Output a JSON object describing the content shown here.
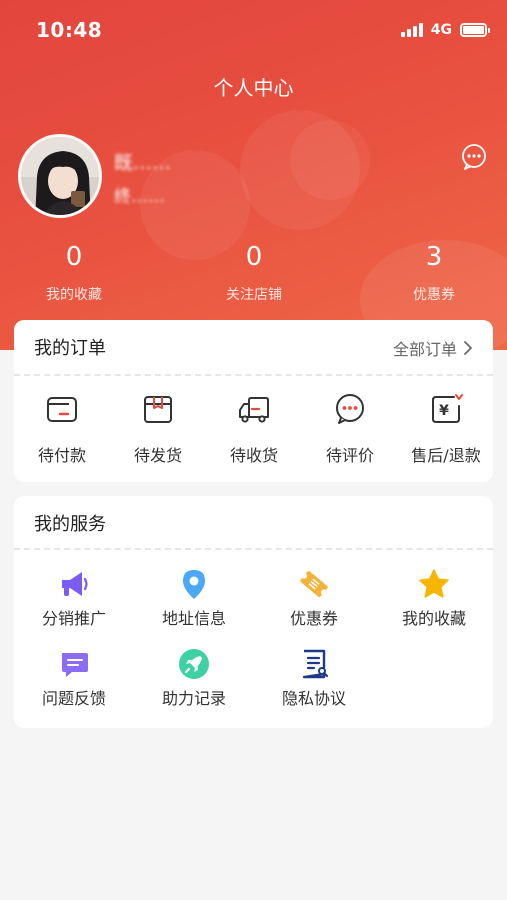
{
  "status_bar": {
    "time": "10:48",
    "network": "4G"
  },
  "header": {
    "title": "个人中心"
  },
  "profile": {
    "name": "既……",
    "subtitle": "终……"
  },
  "stats": [
    {
      "value": "0",
      "label": "我的收藏"
    },
    {
      "value": "0",
      "label": "关注店铺"
    },
    {
      "value": "3",
      "label": "优惠券"
    }
  ],
  "orders": {
    "title": "我的订单",
    "all_link": "全部订单",
    "items": [
      {
        "label": "待付款",
        "icon": "wallet-icon"
      },
      {
        "label": "待发货",
        "icon": "package-icon"
      },
      {
        "label": "待收货",
        "icon": "truck-icon"
      },
      {
        "label": "待评价",
        "icon": "comment-icon"
      },
      {
        "label": "售后/退款",
        "icon": "refund-icon"
      }
    ]
  },
  "services": {
    "title": "我的服务",
    "items": [
      {
        "label": "分销推广",
        "icon": "megaphone-icon"
      },
      {
        "label": "地址信息",
        "icon": "location-pin-icon"
      },
      {
        "label": "优惠券",
        "icon": "coupon-icon"
      },
      {
        "label": "我的收藏",
        "icon": "star-icon"
      },
      {
        "label": "问题反馈",
        "icon": "feedback-icon"
      },
      {
        "label": "助力记录",
        "icon": "rocket-icon"
      },
      {
        "label": "隐私协议",
        "icon": "document-icon"
      }
    ]
  },
  "colors": {
    "header_gradient_start": "#e2453d",
    "header_gradient_end": "#ef6848",
    "accent_red": "#e54b3c",
    "megaphone": "#7a5cf0",
    "location": "#4aa8f5",
    "coupon": "#f3b33a",
    "star": "#f7b500",
    "feedback": "#8b6cf2",
    "rocket": "#3fd0a4",
    "document": "#1e3a8a"
  }
}
